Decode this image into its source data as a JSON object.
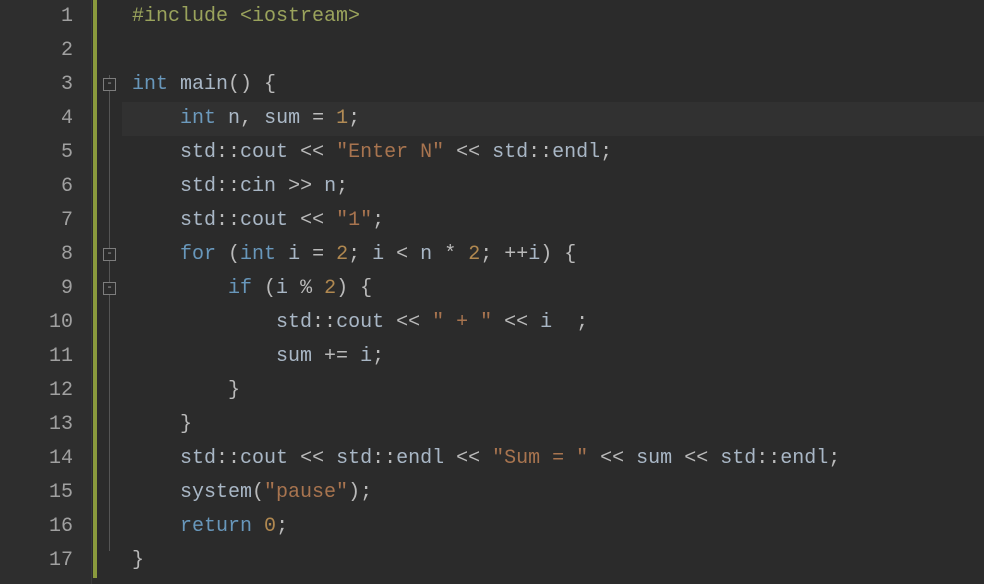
{
  "editor": {
    "highlighted_line_index": 3,
    "mod_bars": [
      {
        "start": 1,
        "end": 17
      }
    ],
    "fold_markers": [
      {
        "line": 3,
        "state": "expanded"
      },
      {
        "line": 8,
        "state": "expanded"
      },
      {
        "line": 9,
        "state": "expanded"
      }
    ],
    "lines": [
      {
        "num": "1",
        "tokens": [
          {
            "cls": "t-pre",
            "t": "#include <iostream>"
          }
        ]
      },
      {
        "num": "2",
        "tokens": []
      },
      {
        "num": "3",
        "tokens": [
          {
            "cls": "t-kw",
            "t": "int"
          },
          {
            "cls": "t-pn",
            "t": " "
          },
          {
            "cls": "t-fn",
            "t": "main"
          },
          {
            "cls": "t-pn",
            "t": "() {"
          }
        ]
      },
      {
        "num": "4",
        "tokens": [
          {
            "cls": "t-pn",
            "t": "    "
          },
          {
            "cls": "t-kw",
            "t": "int"
          },
          {
            "cls": "t-pn",
            "t": " "
          },
          {
            "cls": "t-id",
            "t": "n"
          },
          {
            "cls": "t-pn",
            "t": ", "
          },
          {
            "cls": "t-id",
            "t": "sum"
          },
          {
            "cls": "t-pn",
            "t": " = "
          },
          {
            "cls": "t-num",
            "t": "1"
          },
          {
            "cls": "t-pn",
            "t": ";"
          }
        ]
      },
      {
        "num": "5",
        "tokens": [
          {
            "cls": "t-pn",
            "t": "    "
          },
          {
            "cls": "t-id",
            "t": "std"
          },
          {
            "cls": "t-pn",
            "t": "::"
          },
          {
            "cls": "t-id",
            "t": "cout"
          },
          {
            "cls": "t-pn",
            "t": " << "
          },
          {
            "cls": "t-str",
            "t": "\"Enter N\""
          },
          {
            "cls": "t-pn",
            "t": " << "
          },
          {
            "cls": "t-id",
            "t": "std"
          },
          {
            "cls": "t-pn",
            "t": "::"
          },
          {
            "cls": "t-id",
            "t": "endl"
          },
          {
            "cls": "t-pn",
            "t": ";"
          }
        ]
      },
      {
        "num": "6",
        "tokens": [
          {
            "cls": "t-pn",
            "t": "    "
          },
          {
            "cls": "t-id",
            "t": "std"
          },
          {
            "cls": "t-pn",
            "t": "::"
          },
          {
            "cls": "t-id",
            "t": "cin"
          },
          {
            "cls": "t-pn",
            "t": " >> "
          },
          {
            "cls": "t-id",
            "t": "n"
          },
          {
            "cls": "t-pn",
            "t": ";"
          }
        ]
      },
      {
        "num": "7",
        "tokens": [
          {
            "cls": "t-pn",
            "t": "    "
          },
          {
            "cls": "t-id",
            "t": "std"
          },
          {
            "cls": "t-pn",
            "t": "::"
          },
          {
            "cls": "t-id",
            "t": "cout"
          },
          {
            "cls": "t-pn",
            "t": " << "
          },
          {
            "cls": "t-str",
            "t": "\"1\""
          },
          {
            "cls": "t-pn",
            "t": ";"
          }
        ]
      },
      {
        "num": "8",
        "tokens": [
          {
            "cls": "t-pn",
            "t": "    "
          },
          {
            "cls": "t-kw",
            "t": "for"
          },
          {
            "cls": "t-pn",
            "t": " ("
          },
          {
            "cls": "t-kw",
            "t": "int"
          },
          {
            "cls": "t-pn",
            "t": " "
          },
          {
            "cls": "t-id",
            "t": "i"
          },
          {
            "cls": "t-pn",
            "t": " = "
          },
          {
            "cls": "t-num",
            "t": "2"
          },
          {
            "cls": "t-pn",
            "t": "; "
          },
          {
            "cls": "t-id",
            "t": "i"
          },
          {
            "cls": "t-pn",
            "t": " < "
          },
          {
            "cls": "t-id",
            "t": "n"
          },
          {
            "cls": "t-pn",
            "t": " * "
          },
          {
            "cls": "t-num",
            "t": "2"
          },
          {
            "cls": "t-pn",
            "t": "; ++"
          },
          {
            "cls": "t-id",
            "t": "i"
          },
          {
            "cls": "t-pn",
            "t": ") {"
          }
        ]
      },
      {
        "num": "9",
        "tokens": [
          {
            "cls": "t-pn",
            "t": "        "
          },
          {
            "cls": "t-kw",
            "t": "if"
          },
          {
            "cls": "t-pn",
            "t": " ("
          },
          {
            "cls": "t-id",
            "t": "i"
          },
          {
            "cls": "t-pn",
            "t": " % "
          },
          {
            "cls": "t-num",
            "t": "2"
          },
          {
            "cls": "t-pn",
            "t": ") {"
          }
        ]
      },
      {
        "num": "10",
        "tokens": [
          {
            "cls": "t-pn",
            "t": "            "
          },
          {
            "cls": "t-id",
            "t": "std"
          },
          {
            "cls": "t-pn",
            "t": "::"
          },
          {
            "cls": "t-id",
            "t": "cout"
          },
          {
            "cls": "t-pn",
            "t": " << "
          },
          {
            "cls": "t-str",
            "t": "\" + \""
          },
          {
            "cls": "t-pn",
            "t": " << "
          },
          {
            "cls": "t-id",
            "t": "i"
          },
          {
            "cls": "t-pn",
            "t": "  ;"
          }
        ]
      },
      {
        "num": "11",
        "tokens": [
          {
            "cls": "t-pn",
            "t": "            "
          },
          {
            "cls": "t-id",
            "t": "sum"
          },
          {
            "cls": "t-pn",
            "t": " += "
          },
          {
            "cls": "t-id",
            "t": "i"
          },
          {
            "cls": "t-pn",
            "t": ";"
          }
        ]
      },
      {
        "num": "12",
        "tokens": [
          {
            "cls": "t-pn",
            "t": "        }"
          }
        ]
      },
      {
        "num": "13",
        "tokens": [
          {
            "cls": "t-pn",
            "t": "    }"
          }
        ]
      },
      {
        "num": "14",
        "tokens": [
          {
            "cls": "t-pn",
            "t": "    "
          },
          {
            "cls": "t-id",
            "t": "std"
          },
          {
            "cls": "t-pn",
            "t": "::"
          },
          {
            "cls": "t-id",
            "t": "cout"
          },
          {
            "cls": "t-pn",
            "t": " << "
          },
          {
            "cls": "t-id",
            "t": "std"
          },
          {
            "cls": "t-pn",
            "t": "::"
          },
          {
            "cls": "t-id",
            "t": "endl"
          },
          {
            "cls": "t-pn",
            "t": " << "
          },
          {
            "cls": "t-str",
            "t": "\"Sum = \""
          },
          {
            "cls": "t-pn",
            "t": " << "
          },
          {
            "cls": "t-id",
            "t": "sum"
          },
          {
            "cls": "t-pn",
            "t": " << "
          },
          {
            "cls": "t-id",
            "t": "std"
          },
          {
            "cls": "t-pn",
            "t": "::"
          },
          {
            "cls": "t-id",
            "t": "endl"
          },
          {
            "cls": "t-pn",
            "t": ";"
          }
        ]
      },
      {
        "num": "15",
        "tokens": [
          {
            "cls": "t-pn",
            "t": "    "
          },
          {
            "cls": "t-fn",
            "t": "system"
          },
          {
            "cls": "t-pn",
            "t": "("
          },
          {
            "cls": "t-str",
            "t": "\"pause\""
          },
          {
            "cls": "t-pn",
            "t": ");"
          }
        ]
      },
      {
        "num": "16",
        "tokens": [
          {
            "cls": "t-pn",
            "t": "    "
          },
          {
            "cls": "t-kw",
            "t": "return"
          },
          {
            "cls": "t-pn",
            "t": " "
          },
          {
            "cls": "t-num",
            "t": "0"
          },
          {
            "cls": "t-pn",
            "t": ";"
          }
        ]
      },
      {
        "num": "17",
        "tokens": [
          {
            "cls": "t-pn",
            "t": "}"
          }
        ]
      }
    ]
  }
}
